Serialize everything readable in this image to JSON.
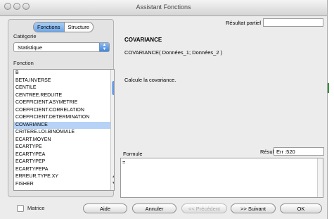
{
  "window": {
    "title": "Assistant Fonctions"
  },
  "tabs": [
    {
      "label": "Fonctions",
      "active": true
    },
    {
      "label": "Structure",
      "active": false
    }
  ],
  "categorie": {
    "label": "Catégorie",
    "selected": "Statistique"
  },
  "fonction": {
    "label": "Fonction",
    "items": [
      "B",
      "BETA.INVERSE",
      "CENTILE",
      "CENTREE.REDUITE",
      "COEFFICIENT.ASYMETRIE",
      "COEFFICIENT.CORRELATION",
      "COEFFICIENT.DETERMINATION",
      "COVARIANCE",
      "CRITERE.LOI.BINOMIALE",
      "ECART.MOYEN",
      "ECARTYPE",
      "ECARTYPEA",
      "ECARTYPEP",
      "ECARTYPEPA",
      "ERREUR.TYPE.XY",
      "FISHER"
    ],
    "selected_index": 7
  },
  "resultat_partiel": {
    "label": "Résultat partiel",
    "value": ""
  },
  "details": {
    "name": "COVARIANCE",
    "syntax": "COVARIANCE( Données_1; Données_2 )",
    "description": "Calcule la covariance."
  },
  "formule": {
    "label": "Formule",
    "value": "="
  },
  "resultat": {
    "label": "Résultat",
    "value": "Err :520"
  },
  "matrice": {
    "label": "Matrice",
    "checked": false
  },
  "buttons": {
    "aide": "Aide",
    "annuler": "Annuler",
    "precedent": "<< Précédent",
    "suivant": ">> Suivant",
    "ok": "OK"
  },
  "colors": {
    "selection": "#b6d2f6",
    "accent": "#3f87de"
  }
}
